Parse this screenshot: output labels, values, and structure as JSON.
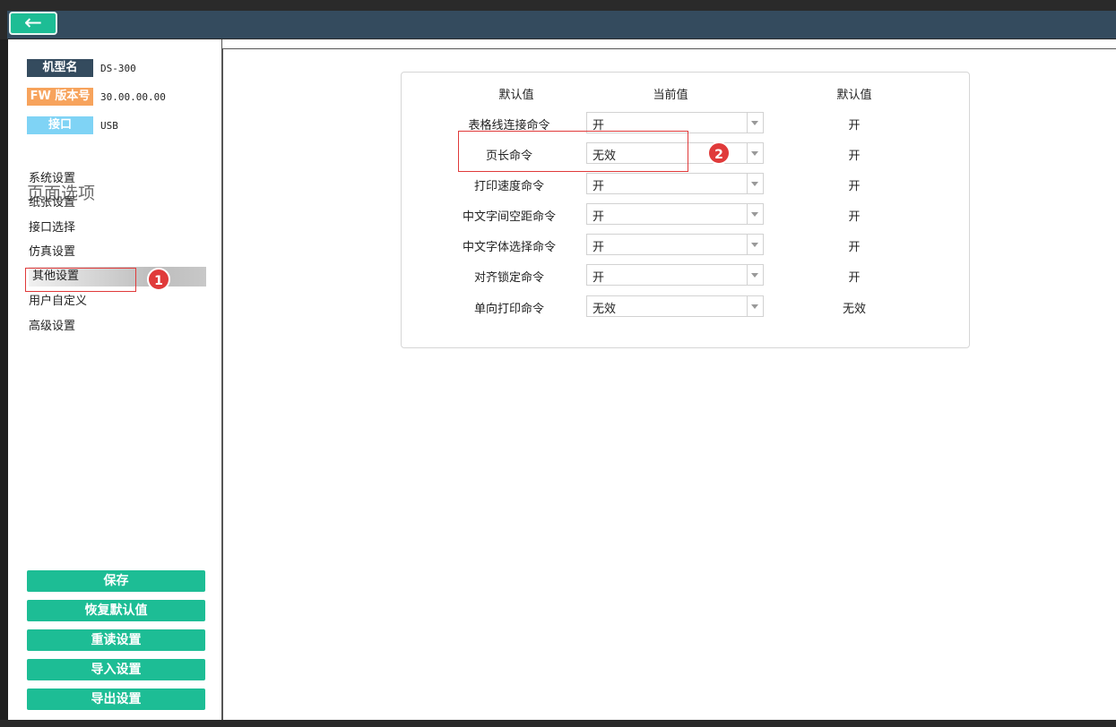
{
  "device_info": [
    {
      "label": "机型名",
      "value": "DS-300",
      "color": "#344b5e"
    },
    {
      "label": "FW 版本号",
      "value": "30.00.00.00",
      "color": "#f7a35c"
    },
    {
      "label": "接口",
      "value": "USB",
      "color": "#7fd3f5"
    }
  ],
  "sidebar": {
    "section_title": "页面选项",
    "items": [
      {
        "label": "系统设置"
      },
      {
        "label": "纸张设置"
      },
      {
        "label": "接口选择"
      },
      {
        "label": "仿真设置"
      },
      {
        "label": "其他设置",
        "active": true
      },
      {
        "label": "用户自定义"
      },
      {
        "label": "高级设置"
      }
    ]
  },
  "actions": {
    "save": "保存",
    "restore_defaults": "恢复默认值",
    "reload": "重读设置",
    "import": "导入设置",
    "export": "导出设置"
  },
  "table": {
    "headers": [
      "默认值",
      "当前值",
      "默认值"
    ],
    "rows": [
      {
        "name": "表格线连接命令",
        "current": "开",
        "default": "开"
      },
      {
        "name": "页长命令",
        "current": "无效",
        "default": "开"
      },
      {
        "name": "打印速度命令",
        "current": "开",
        "default": "开"
      },
      {
        "name": "中文字间空距命令",
        "current": "开",
        "default": "开"
      },
      {
        "name": "中文字体选择命令",
        "current": "开",
        "default": "开"
      },
      {
        "name": "对齐锁定命令",
        "current": "开",
        "default": "开"
      },
      {
        "name": "单向打印命令",
        "current": "无效",
        "default": "无效"
      }
    ]
  },
  "annotations": {
    "badge_1": "1",
    "badge_2": "2"
  },
  "colors": {
    "accent": "#1dbd95",
    "header_bar": "#344b5e",
    "highlight": "#e03a3a"
  }
}
